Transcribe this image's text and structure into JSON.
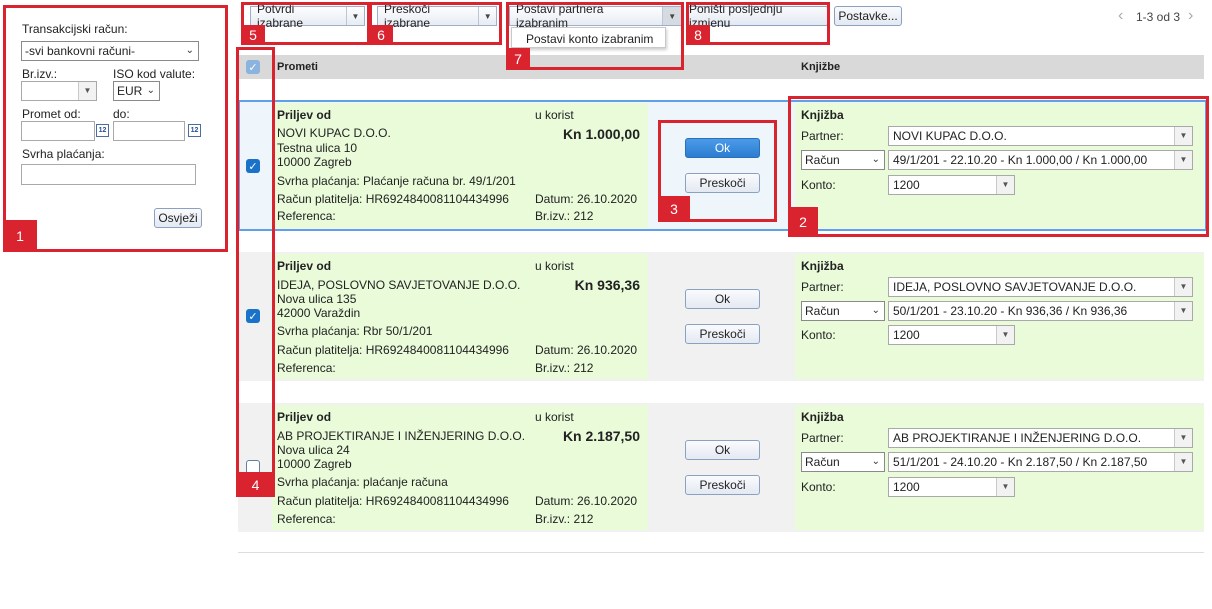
{
  "filter": {
    "account_label": "Transakcijski račun:",
    "account_value": "-svi bankovni računi-",
    "stmt_label": "Br.izv.:",
    "iso_label": "ISO kod valute:",
    "iso_value": "EUR",
    "from_label": "Promet od:",
    "to_label": "do:",
    "purpose_label": "Svrha plaćanja:",
    "refresh_label": "Osvježi",
    "cal_glyph": "12"
  },
  "toolbar": {
    "confirm_label": "Potvrdi izabrane",
    "skip_label": "Preskoči izabrane",
    "set_partner_label": "Postavi partnera izabranim",
    "set_account_item": "Postavi konto izabranim",
    "undo_label": "Poništi posljednju izmjenu",
    "settings_label": "Postavke...",
    "pager_text": "1-3 od 3"
  },
  "headers": {
    "transactions": "Prometi",
    "postings": "Knjižbe"
  },
  "callouts": [
    "1",
    "2",
    "3",
    "4",
    "5",
    "6",
    "7",
    "8"
  ],
  "rows": [
    {
      "title": "Priljev od",
      "company": "NOVI  KUPAC D.O.O.",
      "street": "Testna ulica 10",
      "city": "10000 Zagreb",
      "purpose": "Svrha plaćanja: Plaćanje računa br. 49/1/201",
      "payer": "Račun platitelja: HR6924840081104434996",
      "reference": "Referenca:",
      "in_favor": "u korist",
      "amount": "Kn 1.000,00",
      "date": "Datum: 26.10.2020",
      "stmt": "Br.izv.: 212",
      "ok": "Ok",
      "skip": "Preskoči",
      "posting_title": "Knjižba",
      "partner_label": "Partner:",
      "partner_value": "NOVI  KUPAC D.O.O.",
      "doc_type": "Račun",
      "doc_value": "49/1/201 - 22.10.20 - Kn 1.000,00 / Kn 1.000,00",
      "konto_label": "Konto:",
      "konto_value": "1200",
      "checked": true
    },
    {
      "title": "Priljev od",
      "company": "IDEJA, POSLOVNO SAVJETOVANJE D.O.O.",
      "street": "Nova ulica 135",
      "city": "42000 Varaždin",
      "purpose": "Svrha plaćanja: Rbr 50/1/201",
      "payer": "Račun platitelja: HR6924840081104434996",
      "reference": "Referenca:",
      "in_favor": "u korist",
      "amount": "Kn 936,36",
      "date": "Datum: 26.10.2020",
      "stmt": "Br.izv.: 212",
      "ok": "Ok",
      "skip": "Preskoči",
      "posting_title": "Knjižba",
      "partner_label": "Partner:",
      "partner_value": "IDEJA, POSLOVNO SAVJETOVANJE D.O.O.",
      "doc_type": "Račun",
      "doc_value": "50/1/201 - 23.10.20 - Kn 936,36 / Kn 936,36",
      "konto_label": "Konto:",
      "konto_value": "1200",
      "checked": true
    },
    {
      "title": "Priljev od",
      "company": "AB PROJEKTIRANJE I INŽENJERING D.O.O.",
      "street": "Nova ulica 24",
      "city": "10000 Zagreb",
      "purpose": "Svrha plaćanja: plaćanje računa",
      "payer": "Račun platitelja: HR6924840081104434996",
      "reference": "Referenca:",
      "in_favor": "u korist",
      "amount": "Kn 2.187,50",
      "date": "Datum: 26.10.2020",
      "stmt": "Br.izv.: 212",
      "ok": "Ok",
      "skip": "Preskoči",
      "posting_title": "Knjižba",
      "partner_label": "Partner:",
      "partner_value": "AB PROJEKTIRANJE I INŽENJERING D.O.O.",
      "doc_type": "Račun",
      "doc_value": "51/1/201 - 24.10.20 - Kn 2.187,50 / Kn 2.187,50",
      "konto_label": "Konto:",
      "konto_value": "1200",
      "checked": false
    }
  ]
}
